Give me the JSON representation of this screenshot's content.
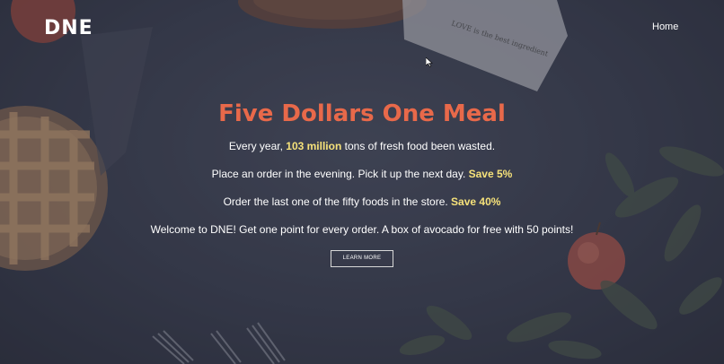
{
  "header": {
    "logo": "DNE",
    "nav": {
      "home_label": "Home"
    }
  },
  "hero": {
    "title": "Five Dollars One Meal",
    "line1": {
      "before": "Every year, ",
      "highlight": "103 million",
      "after": " tons of fresh food been wasted."
    },
    "line2": {
      "before": "Place an order in the evening. Pick it up the next day. ",
      "highlight": "Save 5%"
    },
    "line3": {
      "before": "Order the last one of the fifty foods in the store. ",
      "highlight": "Save 40%"
    },
    "line4": "Welcome to DNE! Get one point for every order. A box of avocado for free with 50 points!",
    "button_label": "LEARN MORE"
  },
  "background": {
    "napkin_text": "LOVE is the best ingredient"
  },
  "colors": {
    "title": "#e8694a",
    "highlight": "#f6e27a",
    "background": "#3a3e4f"
  },
  "icons": {
    "cursor": "mouse-pointer-icon"
  }
}
